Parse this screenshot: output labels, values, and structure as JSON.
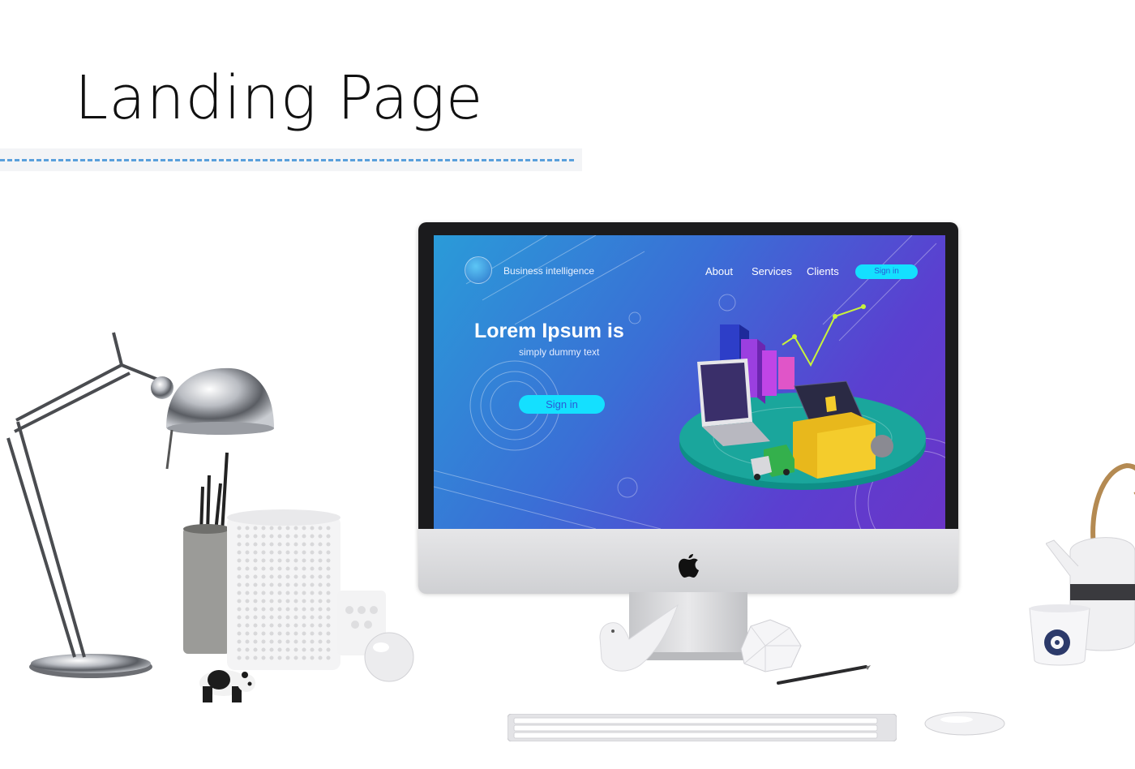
{
  "page": {
    "title": "Landing Page"
  },
  "screen": {
    "brand": "Business intelligence",
    "nav": {
      "about": "About",
      "services": "Services",
      "clients": "Clients",
      "signin": "Sign in"
    },
    "hero": {
      "title": "Lorem Ipsum is",
      "subtitle": "simply dummy text",
      "cta": "Sign in"
    }
  },
  "colors": {
    "accent": "#14e0ff",
    "gradient_start": "#2a9bd8",
    "gradient_end": "#6a35c8",
    "dash": "#5aa0dc"
  },
  "icons": [
    "apple-logo-icon",
    "analytics-logo-icon"
  ]
}
